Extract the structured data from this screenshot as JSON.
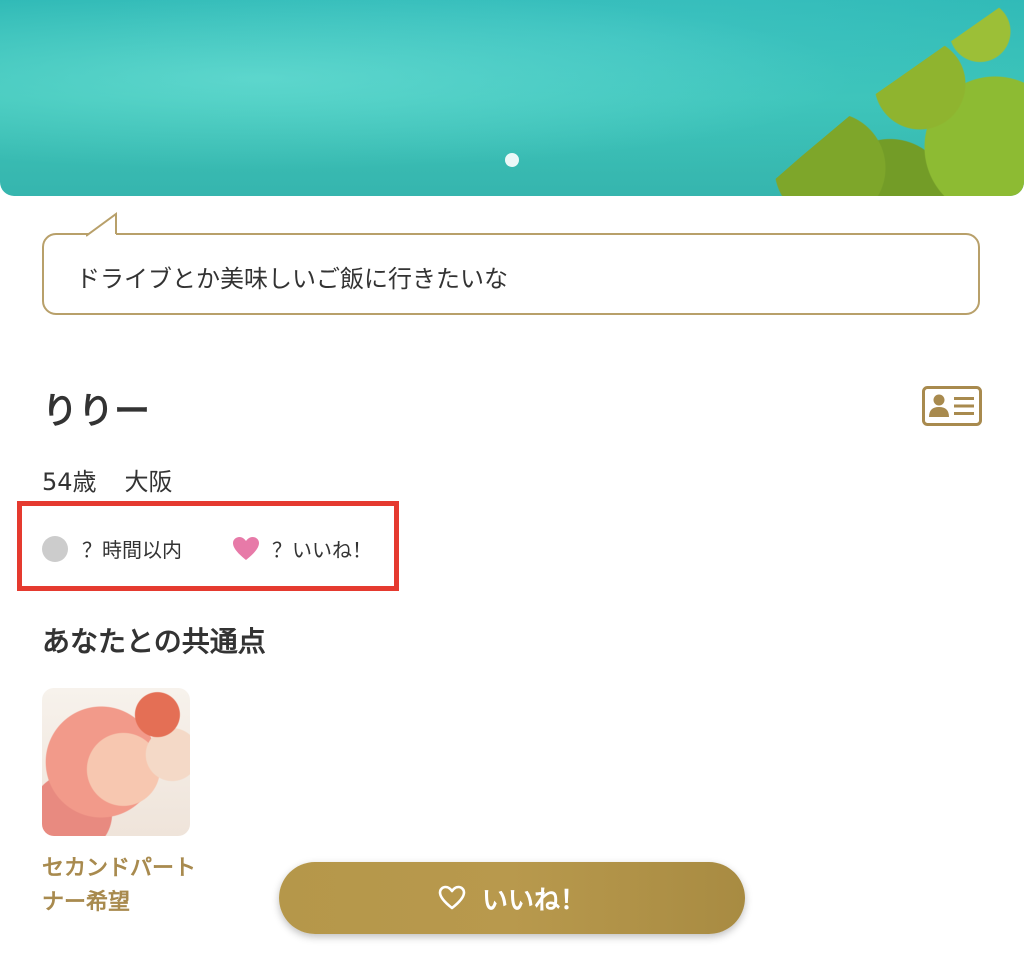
{
  "hero": {
    "active_slide": 1,
    "slide_count": 1
  },
  "bubble": {
    "text": "ドライブとか美味しいご飯に行きたいな"
  },
  "profile": {
    "name": "りりー",
    "age": "54歳",
    "location": "大阪",
    "status": {
      "login_text": "？時間以内",
      "likes_text": "？いいね！"
    }
  },
  "common": {
    "title": "あなたとの共通点",
    "items": [
      {
        "label": "セカンドパートナー希望"
      }
    ]
  },
  "like_button": {
    "label": "いいね！"
  },
  "colors": {
    "accent_gold": "#b5974a",
    "highlight_red": "#e53a2f",
    "heart_pink": "#e77aa8",
    "status_gray": "#cccccc"
  },
  "icons": {
    "card": "profile-card-icon",
    "heart_filled": "heart-icon",
    "heart_outline": "heart-outline-icon",
    "status": "status-dot-icon"
  }
}
